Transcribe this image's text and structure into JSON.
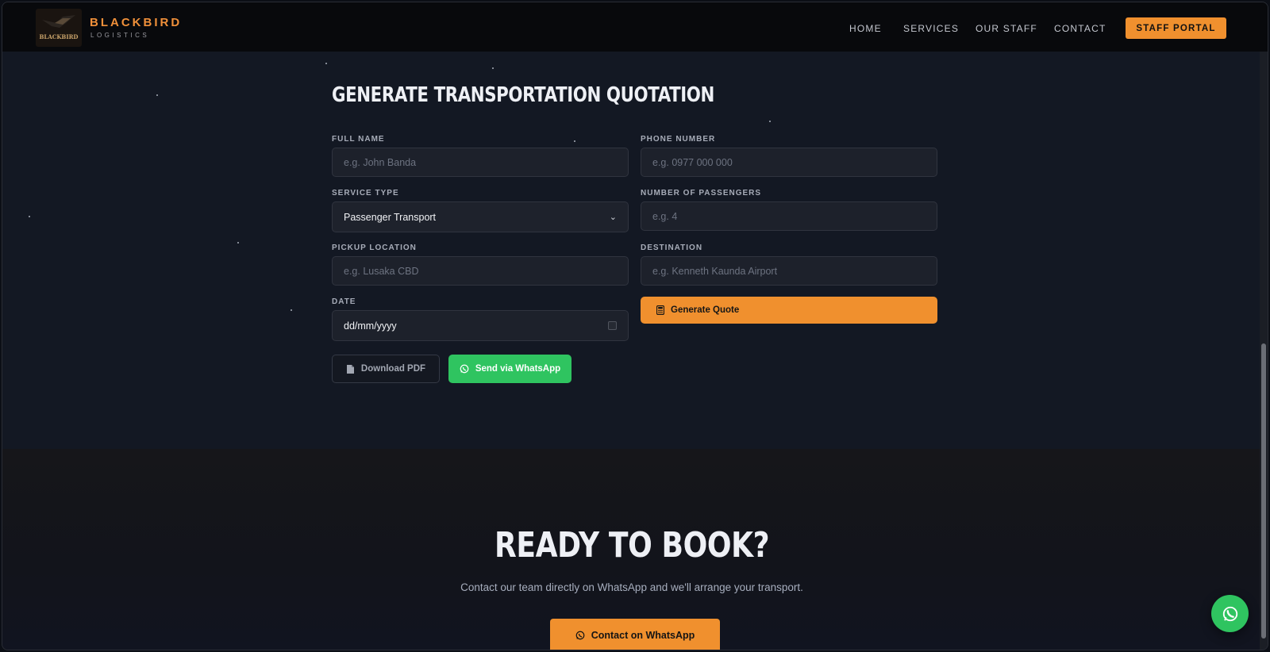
{
  "brand": {
    "name": "BLACKBIRD",
    "tagline": "LOGISTICS",
    "logo_text": "BLACKBIRD"
  },
  "nav": {
    "links": [
      "HOME",
      "SERVICES",
      "OUR STAFF",
      "CONTACT"
    ],
    "portal_label": "STAFF PORTAL"
  },
  "quote_form": {
    "title": "GENERATE TRANSPORTATION QUOTATION",
    "full_name": {
      "label": "FULL NAME",
      "placeholder": "e.g. John Banda"
    },
    "phone": {
      "label": "PHONE NUMBER",
      "placeholder": "e.g. 0977 000 000"
    },
    "service_type": {
      "label": "SERVICE TYPE",
      "value": "Passenger Transport"
    },
    "passengers": {
      "label": "NUMBER OF PASSENGERS",
      "placeholder": "e.g. 4"
    },
    "pickup": {
      "label": "PICKUP LOCATION",
      "placeholder": "e.g. Lusaka CBD"
    },
    "destination": {
      "label": "DESTINATION",
      "placeholder": "e.g. Kenneth Kaunda Airport"
    },
    "date": {
      "label": "DATE",
      "value": "dd/mm/yyyy"
    },
    "generate_label": "Generate Quote",
    "pdf_label": "Download PDF",
    "whatsapp_label": "Send via WhatsApp"
  },
  "cta": {
    "title": "READY TO BOOK?",
    "text": "Contact our team directly on WhatsApp and we'll arrange your transport.",
    "button_label": "Contact on WhatsApp"
  },
  "icons": {
    "calculator": "calculator-icon",
    "pdf": "file-pdf-icon",
    "whatsapp": "whatsapp-icon",
    "calendar": "calendar-icon"
  },
  "colors": {
    "accent": "#f0902e",
    "whatsapp": "#2fc460",
    "background": "#131823"
  }
}
